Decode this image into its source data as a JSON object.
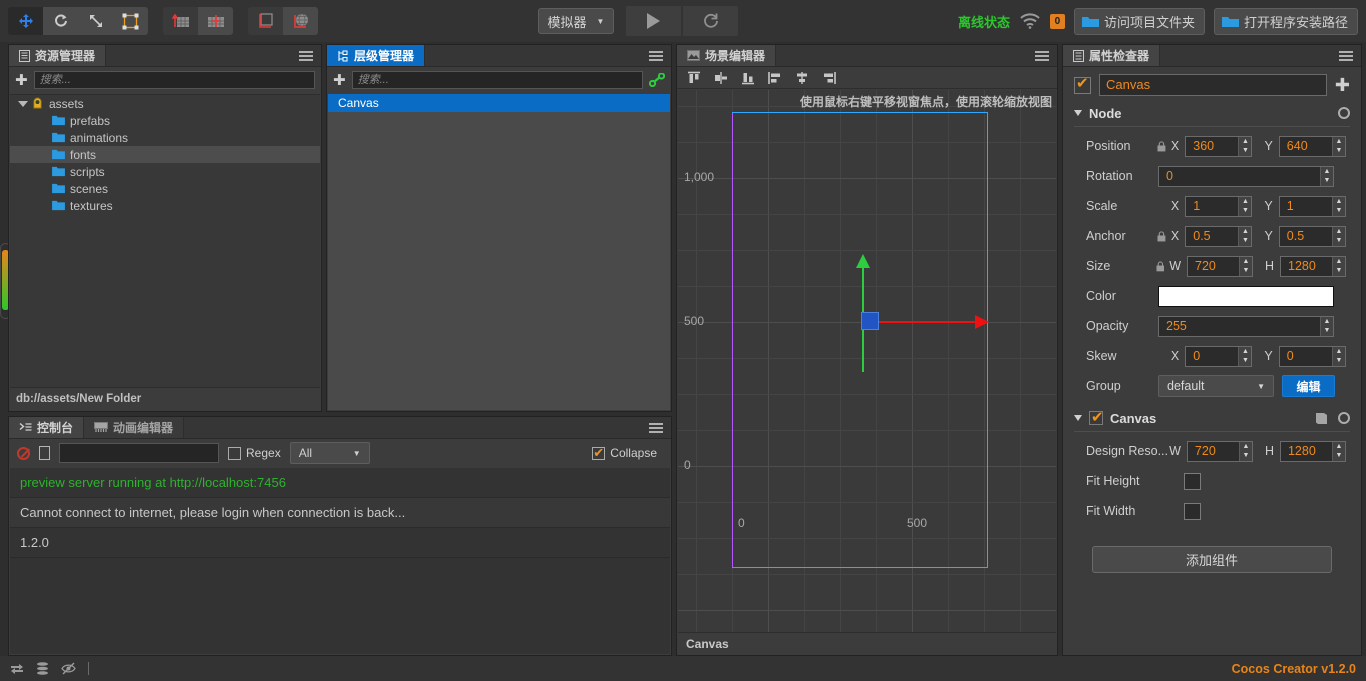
{
  "toolbar": {
    "tools": [
      {
        "name": "move-tool",
        "icon": "move-cross-icon",
        "active": true
      },
      {
        "name": "rotate-tool",
        "icon": "rotate-icon",
        "active": false
      },
      {
        "name": "scale-tool",
        "icon": "scale-icon",
        "active": false
      },
      {
        "name": "rect-transform-tool",
        "icon": "rect-transform-icon",
        "active": false
      }
    ],
    "pivot_tools": [
      {
        "name": "pivot-tool",
        "icon": "pivot-icon"
      },
      {
        "name": "center-tool",
        "icon": "center-icon"
      }
    ],
    "coord_tools": [
      {
        "name": "local-coord-tool",
        "icon": "local-axis-icon"
      },
      {
        "name": "global-coord-tool",
        "icon": "global-axis-icon"
      }
    ],
    "simulator_label": "模拟器",
    "play_label": "play-icon",
    "refresh_label": "refresh-icon",
    "offline_status": "离线状态",
    "wifi_icon": "wifi-icon",
    "notification_count": "0",
    "open_project_folder": "访问项目文件夹",
    "open_install_path": "打开程序安装路径"
  },
  "assets": {
    "tab_title": "资源管理器",
    "search_placeholder": "搜索...",
    "tree": [
      {
        "label": "assets",
        "type": "root",
        "depth": 0,
        "expanded": true,
        "selected": false
      },
      {
        "label": "prefabs",
        "type": "folder",
        "depth": 1,
        "selected": false
      },
      {
        "label": "animations",
        "type": "folder",
        "depth": 1,
        "selected": false
      },
      {
        "label": "fonts",
        "type": "folder",
        "depth": 1,
        "selected": true
      },
      {
        "label": "scripts",
        "type": "folder",
        "depth": 1,
        "selected": false
      },
      {
        "label": "scenes",
        "type": "folder",
        "depth": 1,
        "selected": false
      },
      {
        "label": "textures",
        "type": "folder",
        "depth": 1,
        "selected": false
      }
    ],
    "path": "db://assets/New Folder"
  },
  "hierarchy": {
    "tab_title": "层级管理器",
    "search_placeholder": "搜索...",
    "nodes": [
      {
        "label": "Canvas",
        "selected": true
      }
    ]
  },
  "scene": {
    "tab_title": "场景编辑器",
    "align_tools": [
      {
        "name": "align-top-icon"
      },
      {
        "name": "align-vertical-center-icon"
      },
      {
        "name": "align-bottom-icon"
      },
      {
        "name": "align-left-icon"
      },
      {
        "name": "align-horizontal-center-icon"
      },
      {
        "name": "align-right-icon"
      }
    ],
    "hint": "使用鼠标右键平移视窗焦点，使用滚轮缩放视图",
    "ruler_y": [
      "1,000",
      "500",
      "0"
    ],
    "ruler_x": [
      "0",
      "500"
    ],
    "status": "Canvas"
  },
  "console": {
    "tab_title": "控制台",
    "anim_tab_title": "动画编辑器",
    "filter_value": "",
    "regex_label": "Regex",
    "regex_checked": false,
    "level_selected": "All",
    "collapse_label": "Collapse",
    "collapse_checked": true,
    "messages": [
      {
        "text": "preview server running at http://localhost:7456",
        "level": "info-green"
      },
      {
        "text": "Cannot connect to internet, please login when connection is back...",
        "level": "normal"
      },
      {
        "text": "1.2.0",
        "level": "normal"
      }
    ]
  },
  "inspector": {
    "tab_title": "属性检查器",
    "node_enabled": true,
    "node_name": "Canvas",
    "node_section": {
      "title": "Node",
      "position": {
        "label": "Position",
        "locked": true,
        "x_label": "X",
        "x": "360",
        "y_label": "Y",
        "y": "640"
      },
      "rotation": {
        "label": "Rotation",
        "value": "0"
      },
      "scale": {
        "label": "Scale",
        "x_label": "X",
        "x": "1",
        "y_label": "Y",
        "y": "1"
      },
      "anchor": {
        "label": "Anchor",
        "locked": true,
        "x_label": "X",
        "x": "0.5",
        "y_label": "Y",
        "y": "0.5"
      },
      "size": {
        "label": "Size",
        "locked": true,
        "w_label": "W",
        "w": "720",
        "h_label": "H",
        "h": "1280"
      },
      "color": {
        "label": "Color",
        "value": "#FFFFFF"
      },
      "opacity": {
        "label": "Opacity",
        "value": "255"
      },
      "skew": {
        "label": "Skew",
        "x_label": "X",
        "x": "0",
        "y_label": "Y",
        "y": "0"
      },
      "group": {
        "label": "Group",
        "value": "default",
        "edit_button": "编辑"
      }
    },
    "canvas_section": {
      "title": "Canvas",
      "enabled": true,
      "design_resolution": {
        "label": "Design Reso...",
        "w_label": "W",
        "w": "720",
        "h_label": "H",
        "h": "1280"
      },
      "fit_height": {
        "label": "Fit Height",
        "checked": false
      },
      "fit_width": {
        "label": "Fit Width",
        "checked": false
      }
    },
    "add_component": "添加组件"
  },
  "statusbar": {
    "icons": [
      "sync-icon",
      "database-icon",
      "eye-off-icon"
    ],
    "version": "Cocos Creator v1.2.0"
  },
  "colors": {
    "accent_orange": "#f08a1c",
    "accent_blue": "#0a6cc4",
    "green_status": "#2cc62c",
    "axis_x": "#ee1111",
    "axis_y": "#2ecc3f",
    "canvas_border": "#2fa8ff"
  }
}
